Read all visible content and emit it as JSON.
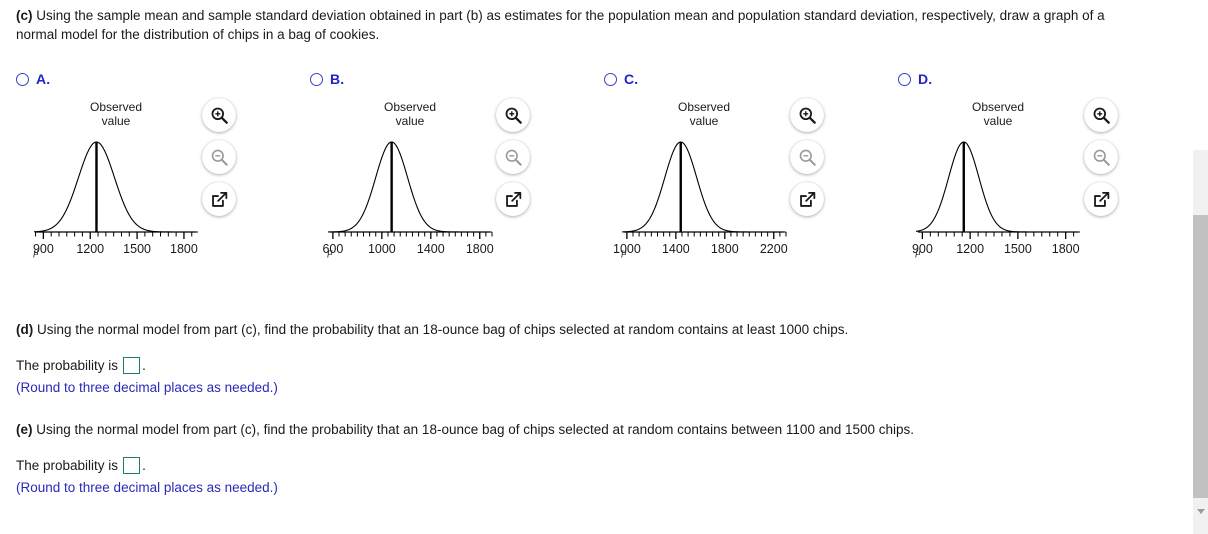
{
  "prompt": {
    "label_c": "(c)",
    "text_c": " Using the sample mean and sample standard deviation obtained in part (b) as estimates for the population mean and population standard deviation, respectively, draw a graph of a normal model for the distribution of chips in a bag of cookies."
  },
  "options": [
    {
      "letter": "A.",
      "name": "option-a",
      "selected": false,
      "title_line1": "Observed",
      "title_line2": "value",
      "mu_symbol": "μ",
      "chart_data": {
        "type": "line",
        "title": "Observed value",
        "xlabel": "",
        "ylabel": "",
        "xlim": [
          840,
          1890
        ],
        "tick_labels": [
          "900",
          "1200",
          "1500",
          "1800"
        ],
        "tick_values": [
          900,
          1200,
          1500,
          1800
        ],
        "minor_tick_step": 50,
        "mean": 1240,
        "sd": 115,
        "mean_line": true,
        "grid": false,
        "legend": null
      },
      "icons": [
        "zoom-in-icon",
        "zoom-out-icon",
        "pop-out-icon"
      ]
    },
    {
      "letter": "B.",
      "name": "option-b",
      "selected": false,
      "title_line1": "Observed",
      "title_line2": "value",
      "mu_symbol": "μ",
      "chart_data": {
        "type": "line",
        "title": "Observed value",
        "xlabel": "",
        "ylabel": "",
        "xlim": [
          560,
          1900
        ],
        "tick_labels": [
          "600",
          "1000",
          "1400",
          "1800"
        ],
        "tick_values": [
          600,
          1000,
          1400,
          1800
        ],
        "minor_tick_step": 50,
        "mean": 1080,
        "sd": 130,
        "mean_line": true,
        "grid": false,
        "legend": null
      },
      "icons": [
        "zoom-in-icon",
        "zoom-out-icon",
        "pop-out-icon"
      ]
    },
    {
      "letter": "C.",
      "name": "option-c",
      "selected": false,
      "title_line1": "Observed",
      "title_line2": "value",
      "mu_symbol": "μ",
      "chart_data": {
        "type": "line",
        "title": "Observed value",
        "xlabel": "",
        "ylabel": "",
        "xlim": [
          960,
          2300
        ],
        "tick_labels": [
          "1000",
          "1400",
          "1800",
          "2200"
        ],
        "tick_values": [
          1000,
          1400,
          1800,
          2200
        ],
        "minor_tick_step": 50,
        "mean": 1440,
        "sd": 130,
        "mean_line": true,
        "grid": false,
        "legend": null
      },
      "icons": [
        "zoom-in-icon",
        "zoom-out-icon",
        "pop-out-icon"
      ]
    },
    {
      "letter": "D.",
      "name": "option-d",
      "selected": false,
      "title_line1": "Observed",
      "title_line2": "value",
      "mu_symbol": "μ",
      "chart_data": {
        "type": "line",
        "title": "Observed value",
        "xlabel": "",
        "ylabel": "",
        "xlim": [
          860,
          1890
        ],
        "tick_labels": [
          "900",
          "1200",
          "1500",
          "1800"
        ],
        "tick_values": [
          900,
          1200,
          1500,
          1800
        ],
        "minor_tick_step": 50,
        "mean": 1160,
        "sd": 95,
        "mean_line": true,
        "grid": false,
        "legend": null
      },
      "icons": [
        "zoom-in-icon",
        "zoom-out-icon",
        "pop-out-icon"
      ]
    }
  ],
  "part_d": {
    "label": "(d)",
    "text": " Using the normal model from part (c), find the probability that an 18-ounce bag of chips selected at random contains at least 1000 chips.",
    "answer_prefix": "The probability is",
    "answer_value": "",
    "answer_suffix": ".",
    "round_note": "(Round to three decimal places as needed.)"
  },
  "part_e": {
    "label": "(e)",
    "text": " Using the normal model from part (c), find the probability that an 18-ounce bag of chips selected at random contains between 1100 and 1500 chips.",
    "answer_prefix": "The probability is",
    "answer_value": "",
    "answer_suffix": ".",
    "round_note": "(Round to three decimal places as needed.)"
  },
  "scrollbar": {
    "name": "vertical-scrollbar",
    "thumb_name": "scrollbar-thumb",
    "arrow_name": "scroll-down-arrow"
  },
  "colors": {
    "option_letter": "#2222cc",
    "radio_border": "#3a41c8",
    "note_blue": "#2a2ab8",
    "answer_box_border": "#1e7d6e",
    "text": "#1a1a1a",
    "icon_active": "#1a1a1a",
    "icon_disabled": "#9a9a9a",
    "scroll_thumb": "#c1c1c1",
    "scroll_track": "#f1f1f1"
  }
}
